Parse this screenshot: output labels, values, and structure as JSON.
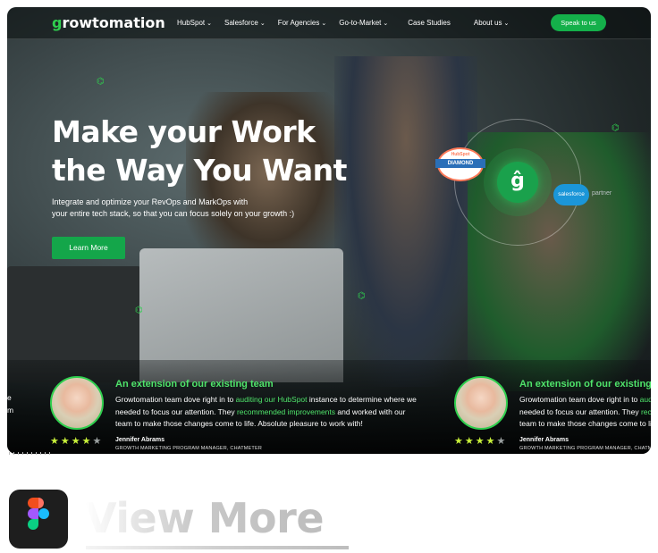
{
  "nav": {
    "logo": "growtomation",
    "logo_mark": "g",
    "items": [
      {
        "label": "HubSpot",
        "chevron": true
      },
      {
        "label": "Salesforce",
        "chevron": true
      },
      {
        "label": "For Agencies",
        "chevron": true
      },
      {
        "label": "Go-to-Market",
        "chevron": true
      },
      {
        "label": "Case Studies",
        "chevron": false
      },
      {
        "label": "About us",
        "chevron": true
      }
    ],
    "cta": "Speak to us"
  },
  "hero": {
    "title": "Make your Work the Way You Want",
    "subtitle_line1": "Integrate and optimize your RevOps and MarkOps with",
    "subtitle_line2": "your entire tech stack, so that you can focus solely on your growth :)",
    "button": "Learn More"
  },
  "badges": {
    "hubspot_diamond": "DIAMOND",
    "hubspot_top": "HubSpot",
    "center_mark": "ĝ",
    "salesforce": "salesforce",
    "partner": "partner"
  },
  "testimonials": [
    {
      "title": "An extension of our existing team",
      "body_part1": "Growtomation team dove right in to ",
      "body_link1": "auditing our HubSpot",
      "body_part2": " instance to determine where we needed to focus our attention. They ",
      "body_link2": "recommended improvements",
      "body_part3": " and worked with our team to make those changes come to life. Absolute pleasure to work with!",
      "rating": 4,
      "name": "Jennifer Abrams",
      "role": "GROWTH MARKETING PROGRAM MANAGER, CHATMETER"
    },
    {
      "title": "An extension of our existing team",
      "body_part1": "Growtomation team dove right in to ",
      "body_link1": "auditing our HubSpot",
      "body_part2": " instance to determine where we needed to focus our attention. They ",
      "body_link2": "recommended improvements",
      "body_part3": " and worked with our team to make those changes come to life. Absolute pleasure to work with!",
      "rating": 4,
      "name": "Jennifer Abrams",
      "role": "GROWTH MARKETING PROGRAM MANAGER, CHATMETER"
    }
  ],
  "left_fragment": {
    "line1": "e",
    "line2": "m"
  },
  "footer": {
    "view_more": "View More",
    "app_icon": "figma-icon"
  },
  "colors": {
    "brand_green": "#14b04a",
    "accent_green": "#4fe36a",
    "star_yellow": "#c8f03a"
  }
}
